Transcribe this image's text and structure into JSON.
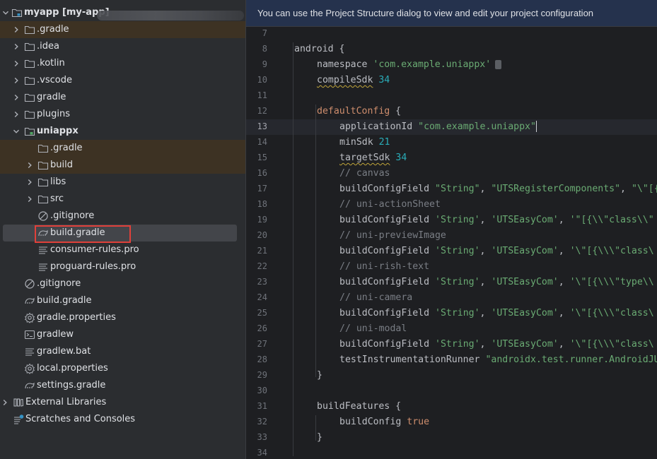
{
  "project_tree": {
    "root": {
      "name": "myapp",
      "module": "[my-app]"
    },
    "items": [
      {
        "label": ".gradle",
        "icon": "folder-icon"
      },
      {
        "label": ".idea",
        "icon": "folder-icon"
      },
      {
        "label": ".kotlin",
        "icon": "folder-icon"
      },
      {
        "label": ".vscode",
        "icon": "folder-icon"
      },
      {
        "label": "gradle",
        "icon": "folder-icon"
      },
      {
        "label": "plugins",
        "icon": "folder-icon"
      },
      {
        "label": "uniappx",
        "icon": "module-folder-icon"
      },
      {
        "label": ".gradle",
        "icon": "folder-icon"
      },
      {
        "label": "build",
        "icon": "folder-icon"
      },
      {
        "label": "libs",
        "icon": "folder-icon"
      },
      {
        "label": "src",
        "icon": "folder-icon"
      },
      {
        "label": ".gitignore",
        "icon": "ignore-file-icon"
      },
      {
        "label": "build.gradle",
        "icon": "gradle-file-icon"
      },
      {
        "label": "consumer-rules.pro",
        "icon": "text-file-icon"
      },
      {
        "label": "proguard-rules.pro",
        "icon": "text-file-icon"
      },
      {
        "label": ".gitignore",
        "icon": "ignore-file-icon"
      },
      {
        "label": "build.gradle",
        "icon": "gradle-file-icon"
      },
      {
        "label": "gradle.properties",
        "icon": "settings-file-icon"
      },
      {
        "label": "gradlew",
        "icon": "terminal-file-icon"
      },
      {
        "label": "gradlew.bat",
        "icon": "text-file-icon"
      },
      {
        "label": "local.properties",
        "icon": "settings-file-icon"
      },
      {
        "label": "settings.gradle",
        "icon": "gradle-file-icon"
      },
      {
        "label": "External Libraries",
        "icon": "libraries-icon"
      },
      {
        "label": "Scratches and Consoles",
        "icon": "scratches-icon"
      }
    ]
  },
  "editor": {
    "banner": "You can use the Project Structure dialog to view and edit your project configuration",
    "current_line": "13",
    "line_numbers": [
      "7",
      "8",
      "9",
      "10",
      "11",
      "12",
      "13",
      "14",
      "15",
      "16",
      "17",
      "18",
      "19",
      "20",
      "21",
      "22",
      "23",
      "24",
      "25",
      "26",
      "27",
      "28",
      "29",
      "30",
      "31",
      "32",
      "33",
      "34"
    ],
    "code": {
      "android_kw": "android",
      "brace_open": " {",
      "brace_close": "}",
      "namespace_kw": "namespace",
      "namespace_val": "'com.example.uniappx'",
      "compileSdk_kw": "compileSdk",
      "compileSdk_val": "34",
      "defaultConfig_kw": "defaultConfig",
      "applicationId_kw": "applicationId",
      "applicationId_val": "\"com.example.uniappx\"",
      "minSdk_kw": "minSdk",
      "minSdk_val": "21",
      "targetSdk_kw": "targetSdk",
      "targetSdk_val": "34",
      "c_canvas": "// canvas",
      "bcf": "buildConfigField",
      "l17_a": "\"String\"",
      "l17_b": "\"UTSRegisterComponents\"",
      "l17_c": "\"\\\"[{",
      "c_actionsheet": "// uni-actionSheet",
      "l19_a": "'String'",
      "l19_b": "'UTSEasyCom'",
      "l19_c": "'\"[{\\\\\"class\\\\\"",
      "c_preview": "// uni-previewImage",
      "l21_c": "'\\\"[{\\\\\\\"class\\",
      "c_rishtext": "// uni-rish-text",
      "l23_c": "'\\\"[{\\\\\\\"type\\\\",
      "c_camera": "// uni-camera",
      "l25_c": "'\\\"[{\\\\\\\"class\\",
      "c_modal": "// uni-modal",
      "l27_c": "'\\\"[{\\\\\\\"class\\",
      "runner_kw": "testInstrumentationRunner",
      "runner_val": "\"androidx.test.runner.AndroidJU",
      "buildFeatures_kw": "buildFeatures",
      "buildConfig_kw": "buildConfig",
      "buildConfig_val": "true",
      "comma": ", "
    }
  },
  "colors": {
    "keyword": "#cf8e6d",
    "string": "#6aab73",
    "number": "#2aacb8",
    "comment": "#7a7e85",
    "highlight_box": "#e0403a"
  }
}
